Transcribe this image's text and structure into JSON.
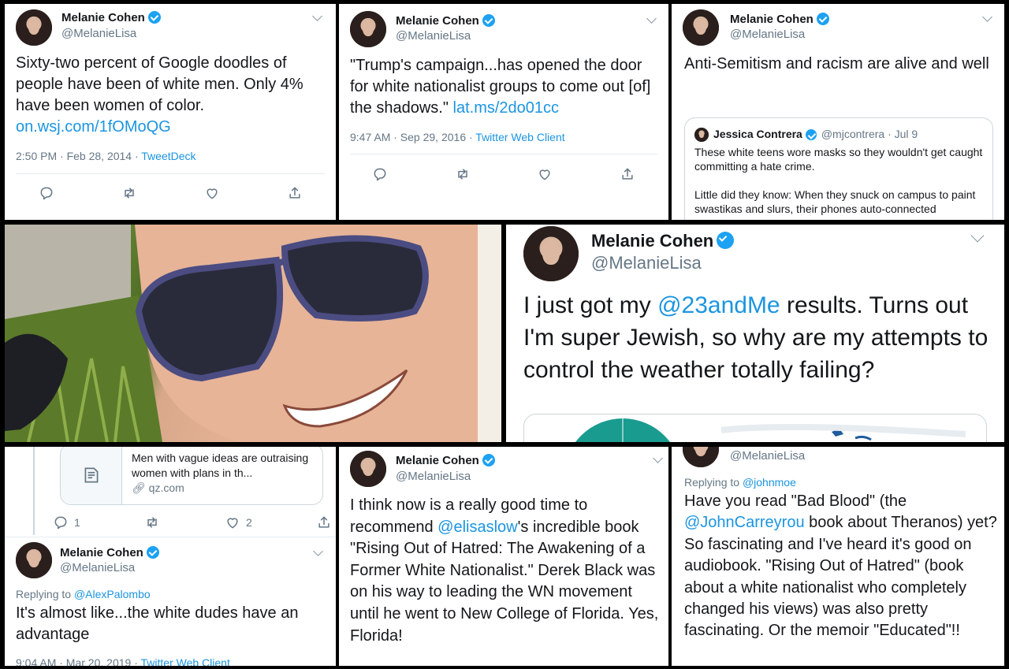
{
  "author": {
    "name": "Melanie Cohen",
    "handle": "@MelanieLisa"
  },
  "tweet1": {
    "text": "Sixty-two percent of Google doodles of people have been of white men. Only 4% have been women of color.",
    "link": "on.wsj.com/1fOMoQG",
    "time": "2:50 PM · Feb 28, 2014 · ",
    "client": "TweetDeck"
  },
  "tweet2": {
    "text": "\"Trump's campaign...has opened the door for white nationalist groups to come out [of] the shadows.\"",
    "link": "lat.ms/2do01cc",
    "time": "9:47 AM · Sep 29, 2016 · ",
    "client": "Twitter Web Client"
  },
  "tweet3": {
    "text": "Anti-Semitism and racism are alive and well",
    "quote": {
      "name": "Jessica Contrera",
      "handle": "@mjcontrera · Jul 9",
      "line1": "These white teens wore masks so they wouldn't get caught committing a hate crime.",
      "line2": "Little did they know: When they snuck on campus to paint swastikas and slurs, their phones auto-connected"
    }
  },
  "tweet4": {
    "text_pre": "I just got my ",
    "mention": "@23andMe",
    "text_post": " results. Turns out I'm super Jewish, so why are my attempts to control the weather totally failing?"
  },
  "tweet5": {
    "card_title": "Men with vague ideas are outraising women with plans in th...",
    "card_domain": "qz.com",
    "reply_count": "1",
    "like_count": "2",
    "replying_label": "Replying to ",
    "replying_to": "@AlexPalombo",
    "text": "It's almost like...the white dudes have an advantage",
    "time": "9:04 AM · Mar 20, 2019 · ",
    "client": "Twitter Web Client"
  },
  "tweet6": {
    "text_pre": "I think now is a really good time to recommend ",
    "mention": "@elisaslow",
    "text_post": "'s incredible book \"Rising Out of Hatred: The Awakening of a Former White Nationalist.\" Derek Black was on his way to leading the WN movement until he went to New College of Florida. Yes, Florida!"
  },
  "tweet7": {
    "replying_label": "Replying to ",
    "replying_to": "@johnmoe",
    "text_pre": "Have you read \"Bad Blood\" (the ",
    "mention": "@JohnCarreyrou",
    "text_post": " book about Theranos) yet? So fascinating and I've heard it's good on audiobook. \"Rising Out of Hatred\" (book about a white nationalist who completely changed his views) was also pretty fascinating. Or the memoir \"Educated\"!!"
  },
  "icons": [
    "reply-icon",
    "retweet-icon",
    "like-icon",
    "share-icon",
    "verified-icon",
    "chevron-down-icon",
    "link-icon",
    "article-icon"
  ],
  "colors": {
    "link": "#1b95e0",
    "verified": "#1da1f2",
    "muted": "#657786",
    "background": "#000000"
  }
}
